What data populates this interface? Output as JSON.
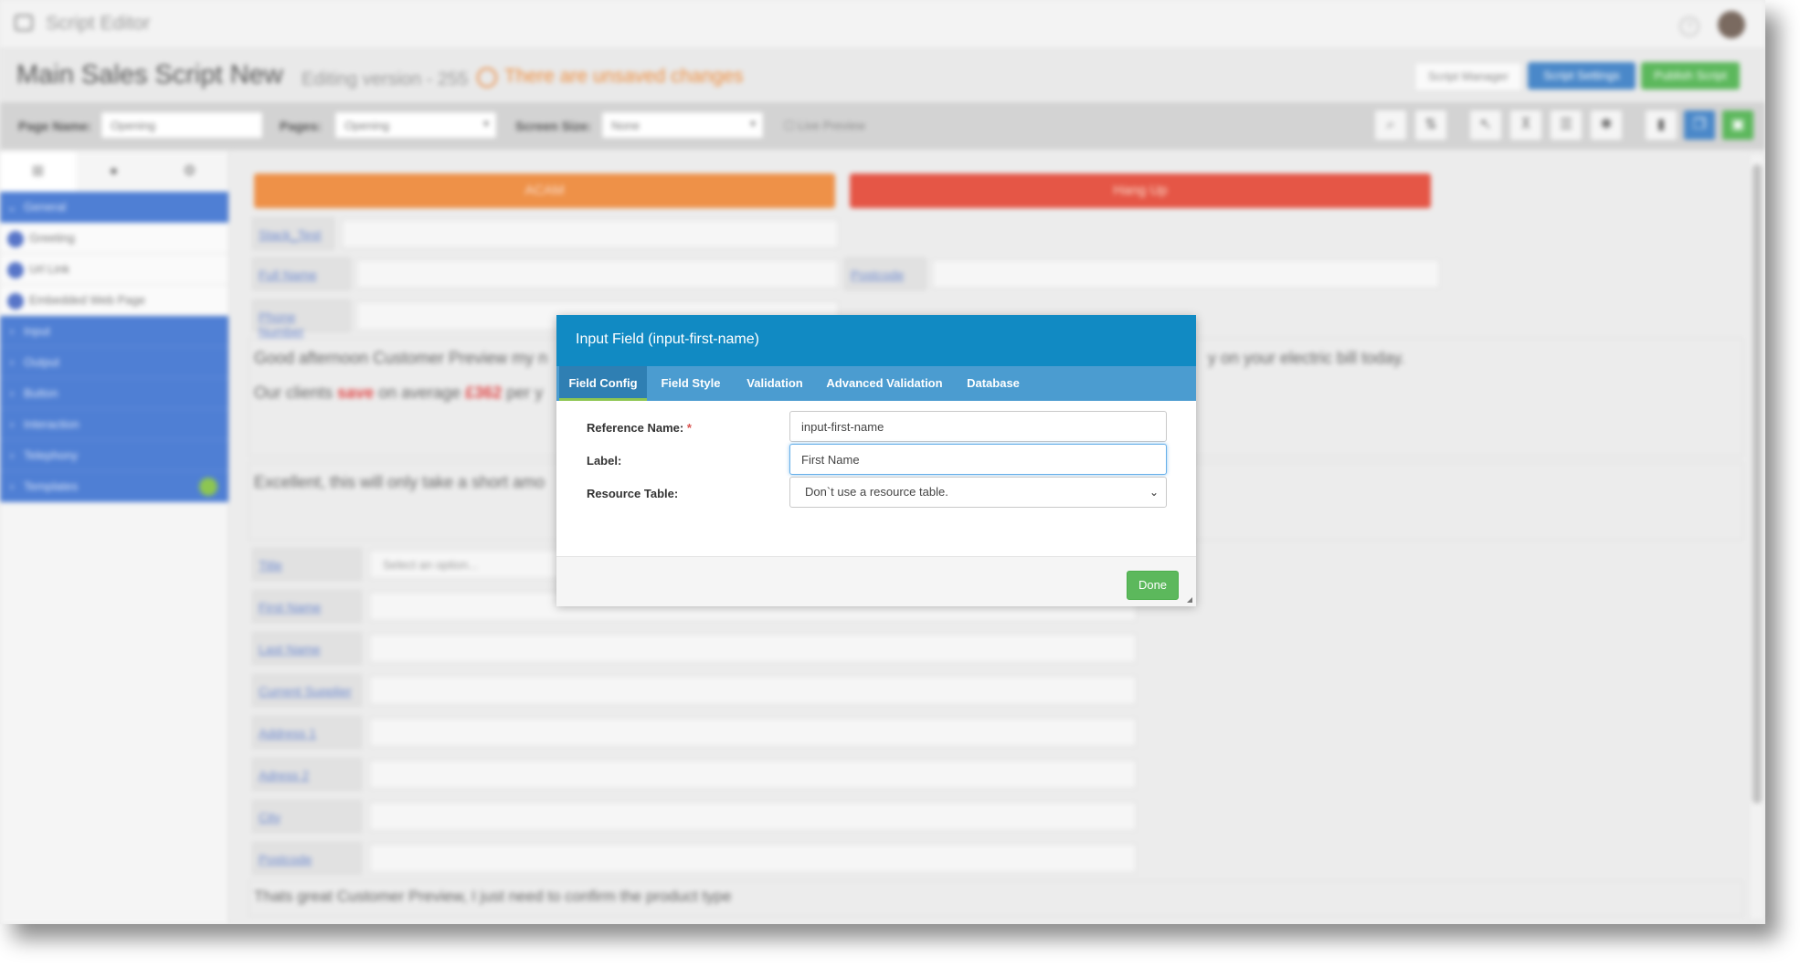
{
  "app": {
    "title": "Script Editor",
    "icons": {
      "logo": "script-logo-icon",
      "help": "help-icon",
      "avatar": "user-avatar"
    }
  },
  "header": {
    "title": "Main Sales Script New",
    "version": "Editing version - 255",
    "warning": "There are unsaved changes",
    "buttons": {
      "script_manager": "Script Manager",
      "script_settings": "Script Settings",
      "publish": "Publish Script"
    },
    "colors": {
      "warning": "#ee8c3c",
      "settings": "#4a88c9",
      "publish": "#5cb85c"
    }
  },
  "toolbar": {
    "page_name_label": "Page Name:",
    "page_name_value": "Opening",
    "pages_label": "Pages:",
    "pages_value": "Opening",
    "screen_size_label": "Screen Size:",
    "screen_size_value": "None",
    "live_preview": "Live Preview"
  },
  "sidebar": {
    "categories": [
      "General",
      "Input",
      "Output",
      "Button",
      "Interaction",
      "Telephony",
      "Templates"
    ],
    "general_items": [
      "Greeting",
      "Url Link",
      "Embedded Web Page"
    ]
  },
  "canvas": {
    "buttons": {
      "accept": "ACAM",
      "hangup": "Hang Up"
    },
    "fields": {
      "stack_test": "Stack_Test",
      "full_name": "Full Name",
      "postcode_top": "Postcode",
      "phone_number": "Phone Number",
      "title": "Title",
      "title_placeholder": "Select an option...",
      "first_name": "First Name",
      "last_name": "Last Name",
      "current_supplier": "Current Supplier",
      "address_1": "Address 1",
      "address_2": "Adress 2",
      "city": "City",
      "postcode": "Postcode"
    },
    "text": {
      "greeting_start": "Good afternoon Customer Preview my n",
      "greeting_end": "y on your electric bill today.",
      "savings_a": "Our clients",
      "savings_b": "save",
      "savings_c": "on average",
      "savings_d": "£362",
      "savings_e": "per y",
      "excellent": "Excellent, this will only take a short amo",
      "confirm": "Thats great Customer Preview, I just need to confirm the product type"
    }
  },
  "modal": {
    "title": "Input Field (input-first-name)",
    "tabs": [
      "Field Config",
      "Field Style",
      "Validation",
      "Advanced Validation",
      "Database"
    ],
    "active_tab": "Field Config",
    "fields": {
      "reference_name_label": "Reference Name:",
      "required_mark": "*",
      "reference_name_value": "input-first-name",
      "label_label": "Label:",
      "label_value": "First Name",
      "resource_table_label": "Resource Table:",
      "resource_table_value": "Don`t use a resource table."
    },
    "done": "Done",
    "colors": {
      "header": "#118ac3",
      "tabs": "#4b9cd0",
      "active_tab": "#2f7fb3",
      "done": "#5cb85c"
    }
  }
}
